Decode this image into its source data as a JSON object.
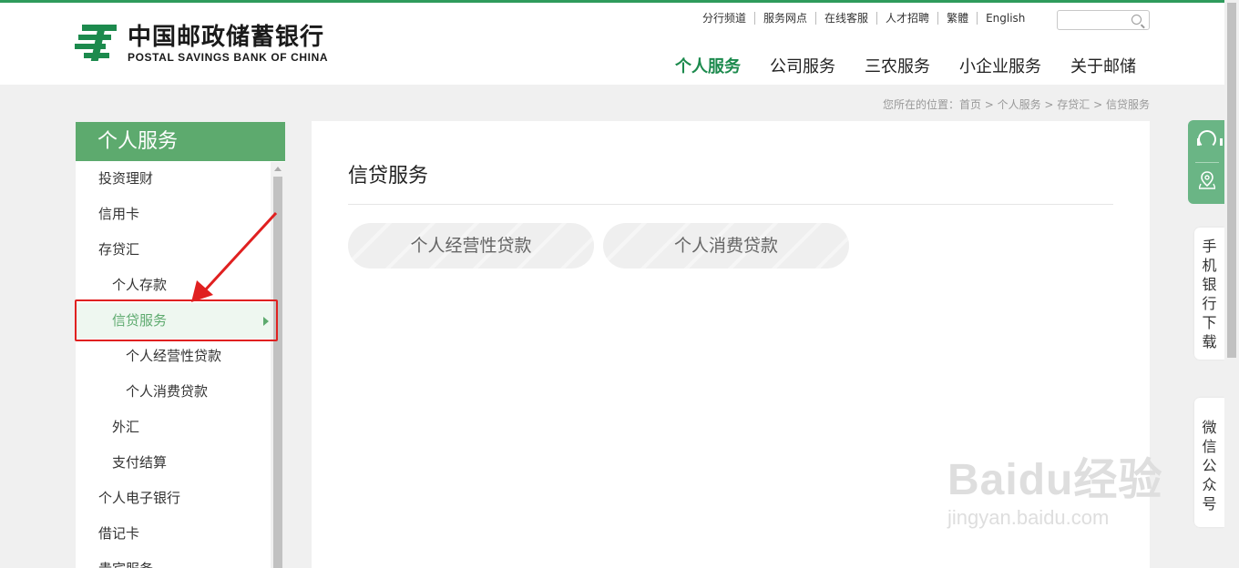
{
  "header": {
    "logo_cn": "中国邮政储蓄银行",
    "logo_en": "POSTAL SAVINGS BANK OF CHINA",
    "top_links": [
      "分行频道",
      "服务网点",
      "在线客服",
      "人才招聘",
      "繁體",
      "English"
    ],
    "search_placeholder": "",
    "nav": [
      {
        "label": "个人服务",
        "active": true
      },
      {
        "label": "公司服务",
        "active": false
      },
      {
        "label": "三农服务",
        "active": false
      },
      {
        "label": "小企业服务",
        "active": false
      },
      {
        "label": "关于邮储",
        "active": false
      }
    ]
  },
  "breadcrumb": "您所在的位置：首页 > 个人服务 > 存贷汇 > 信贷服务",
  "sidebar": {
    "title": "个人服务",
    "items": [
      {
        "label": "投资理财",
        "level": 1
      },
      {
        "label": "信用卡",
        "level": 1
      },
      {
        "label": "存贷汇",
        "level": 1
      },
      {
        "label": "个人存款",
        "level": 2
      },
      {
        "label": "信贷服务",
        "level": 2,
        "active": true
      },
      {
        "label": "个人经营性贷款",
        "level": 3
      },
      {
        "label": "个人消费贷款",
        "level": 3
      },
      {
        "label": "外汇",
        "level": 2
      },
      {
        "label": "支付结算",
        "level": 2
      },
      {
        "label": "个人电子银行",
        "level": 1
      },
      {
        "label": "借记卡",
        "level": 1
      },
      {
        "label": "贵宾服务",
        "level": 1
      }
    ]
  },
  "content": {
    "title": "信贷服务",
    "buttons": [
      "个人经营性贷款",
      "个人消费贷款"
    ]
  },
  "float_tools": {
    "mobile_bank": "手机银行下载",
    "wechat": "微信公众号"
  },
  "watermark": {
    "main": "Baidu经验",
    "sub": "jingyan.baidu.com"
  },
  "colors": {
    "brand_green": "#1c8a4d",
    "sidebar_green": "#5daa6e",
    "annotation_red": "#e02020"
  }
}
